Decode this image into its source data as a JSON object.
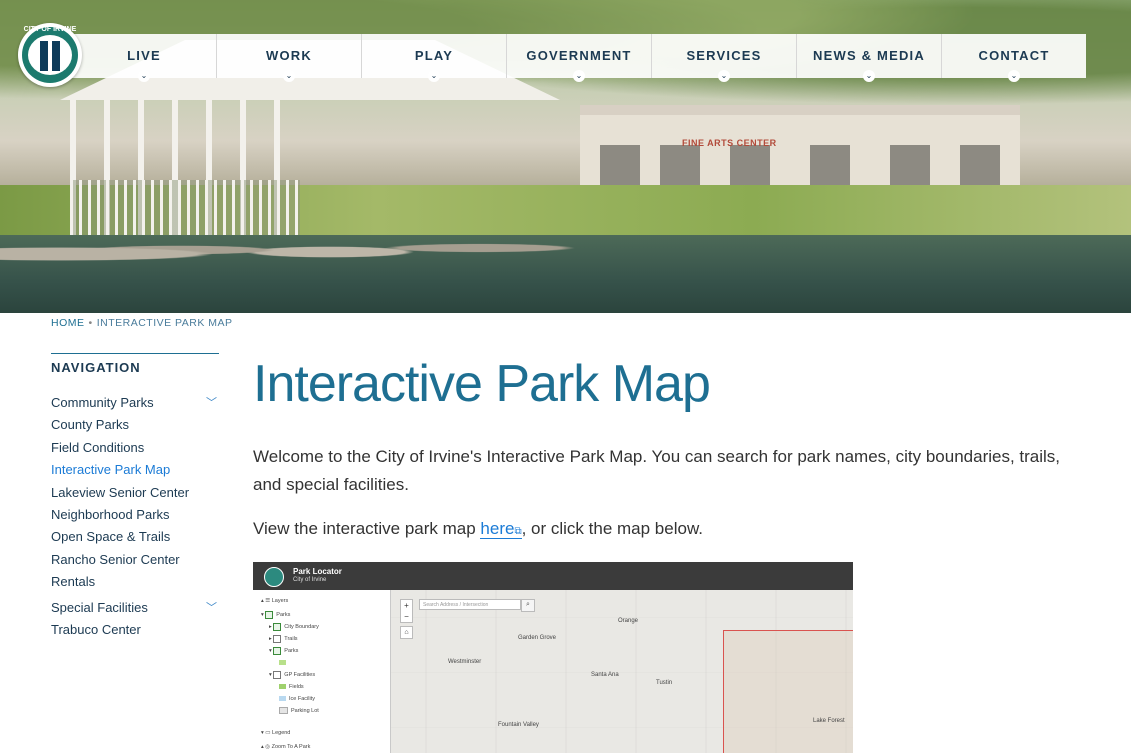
{
  "logo": {
    "text": "CITY OF IRVINE"
  },
  "nav": {
    "items": [
      {
        "label": "LIVE"
      },
      {
        "label": "WORK"
      },
      {
        "label": "PLAY"
      },
      {
        "label": "GOVERNMENT"
      },
      {
        "label": "SERVICES"
      },
      {
        "label": "NEWS & MEDIA"
      },
      {
        "label": "CONTACT"
      }
    ],
    "chevron": "⌄"
  },
  "hero": {
    "sign": "FINE ARTS CENTER"
  },
  "breadcrumb": {
    "home": "HOME",
    "sep": "•",
    "current": "INTERACTIVE PARK MAP"
  },
  "sidebar": {
    "heading": "NAVIGATION",
    "items": [
      {
        "label": "Community Parks",
        "expandable": true
      },
      {
        "label": "County Parks"
      },
      {
        "label": "Field Conditions"
      },
      {
        "label": "Interactive Park Map",
        "active": true
      },
      {
        "label": "Lakeview Senior Center"
      },
      {
        "label": "Neighborhood Parks"
      },
      {
        "label": "Open Space & Trails"
      },
      {
        "label": "Rancho Senior Center"
      },
      {
        "label": "Rentals"
      },
      {
        "label": "Special Facilities",
        "expandable": true
      },
      {
        "label": "Trabuco Center"
      }
    ],
    "expand_glyph": "﹀"
  },
  "main": {
    "title": "Interactive Park Map",
    "intro": "Welcome to the City of Irvine's Interactive Park Map. You can search for park names, city boundaries, trails, and special facilities.",
    "view_prefix": "View the interactive park map ",
    "view_link": "here",
    "view_suffix": ", or click the map below.",
    "ext_icon": "⧉"
  },
  "map": {
    "title": "Park Locator",
    "subtitle": "City of Irvine",
    "search_placeholder": "Search Address / Intersection",
    "layers": [
      {
        "label": "Layers"
      },
      {
        "label": "Parks"
      },
      {
        "label": "City Boundary"
      },
      {
        "label": "Trails"
      },
      {
        "label": "Parks"
      },
      {
        "label": "GP Facilities"
      },
      {
        "label": "Fields"
      },
      {
        "label": "Ice Facility"
      },
      {
        "label": "Parking Lot"
      },
      {
        "label": "Legend"
      },
      {
        "label": "Zoom To A Park"
      }
    ],
    "cities": [
      "Garden Grove",
      "Orange",
      "Westminster",
      "Santa Ana",
      "Tustin",
      "Fountain Valley",
      "Lake Forest"
    ],
    "colors": {
      "accent": "#1e6f92",
      "link": "#1b7bd6",
      "nav_text": "#1c3a52",
      "boundary": "#d9534f"
    }
  }
}
